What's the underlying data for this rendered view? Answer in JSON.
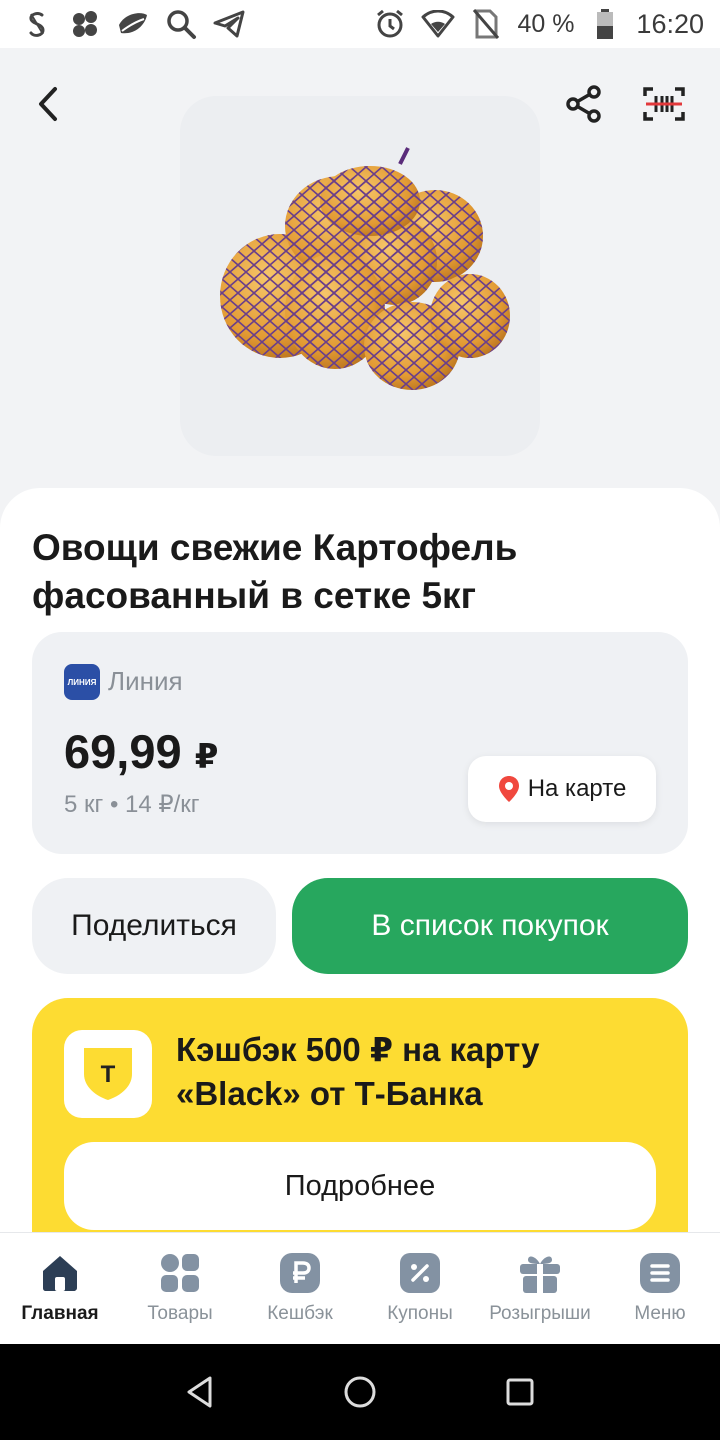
{
  "status_bar": {
    "battery": "40 %",
    "time": "16:20"
  },
  "product": {
    "title": "Овощи свежие Картофель фасованный в сетке 5кг",
    "store": "Линия",
    "store_logo_text": "ЛИНИЯ",
    "price": "69,99",
    "currency": "₽",
    "unit_price": "5 кг • 14 ₽/кг",
    "map_label": "На карте"
  },
  "actions": {
    "share_label": "Поделиться",
    "add_to_list_label": "В список покупок"
  },
  "promo": {
    "text": "Кэшбэк 500 ₽ на карту «Black» от Т-Банка",
    "logo_letter": "T",
    "button_label": "Подробнее"
  },
  "bottom_nav": {
    "items": [
      {
        "label": "Главная",
        "icon": "home-icon"
      },
      {
        "label": "Товары",
        "icon": "grid-icon"
      },
      {
        "label": "Кешбэк",
        "icon": "ruble-icon"
      },
      {
        "label": "Купоны",
        "icon": "percent-icon"
      },
      {
        "label": "Розыгрыши",
        "icon": "gift-icon"
      },
      {
        "label": "Меню",
        "icon": "menu-icon"
      }
    ]
  },
  "colors": {
    "accent_green": "#27a75e",
    "promo_yellow": "#fddc32",
    "map_pin": "#f0483e"
  }
}
